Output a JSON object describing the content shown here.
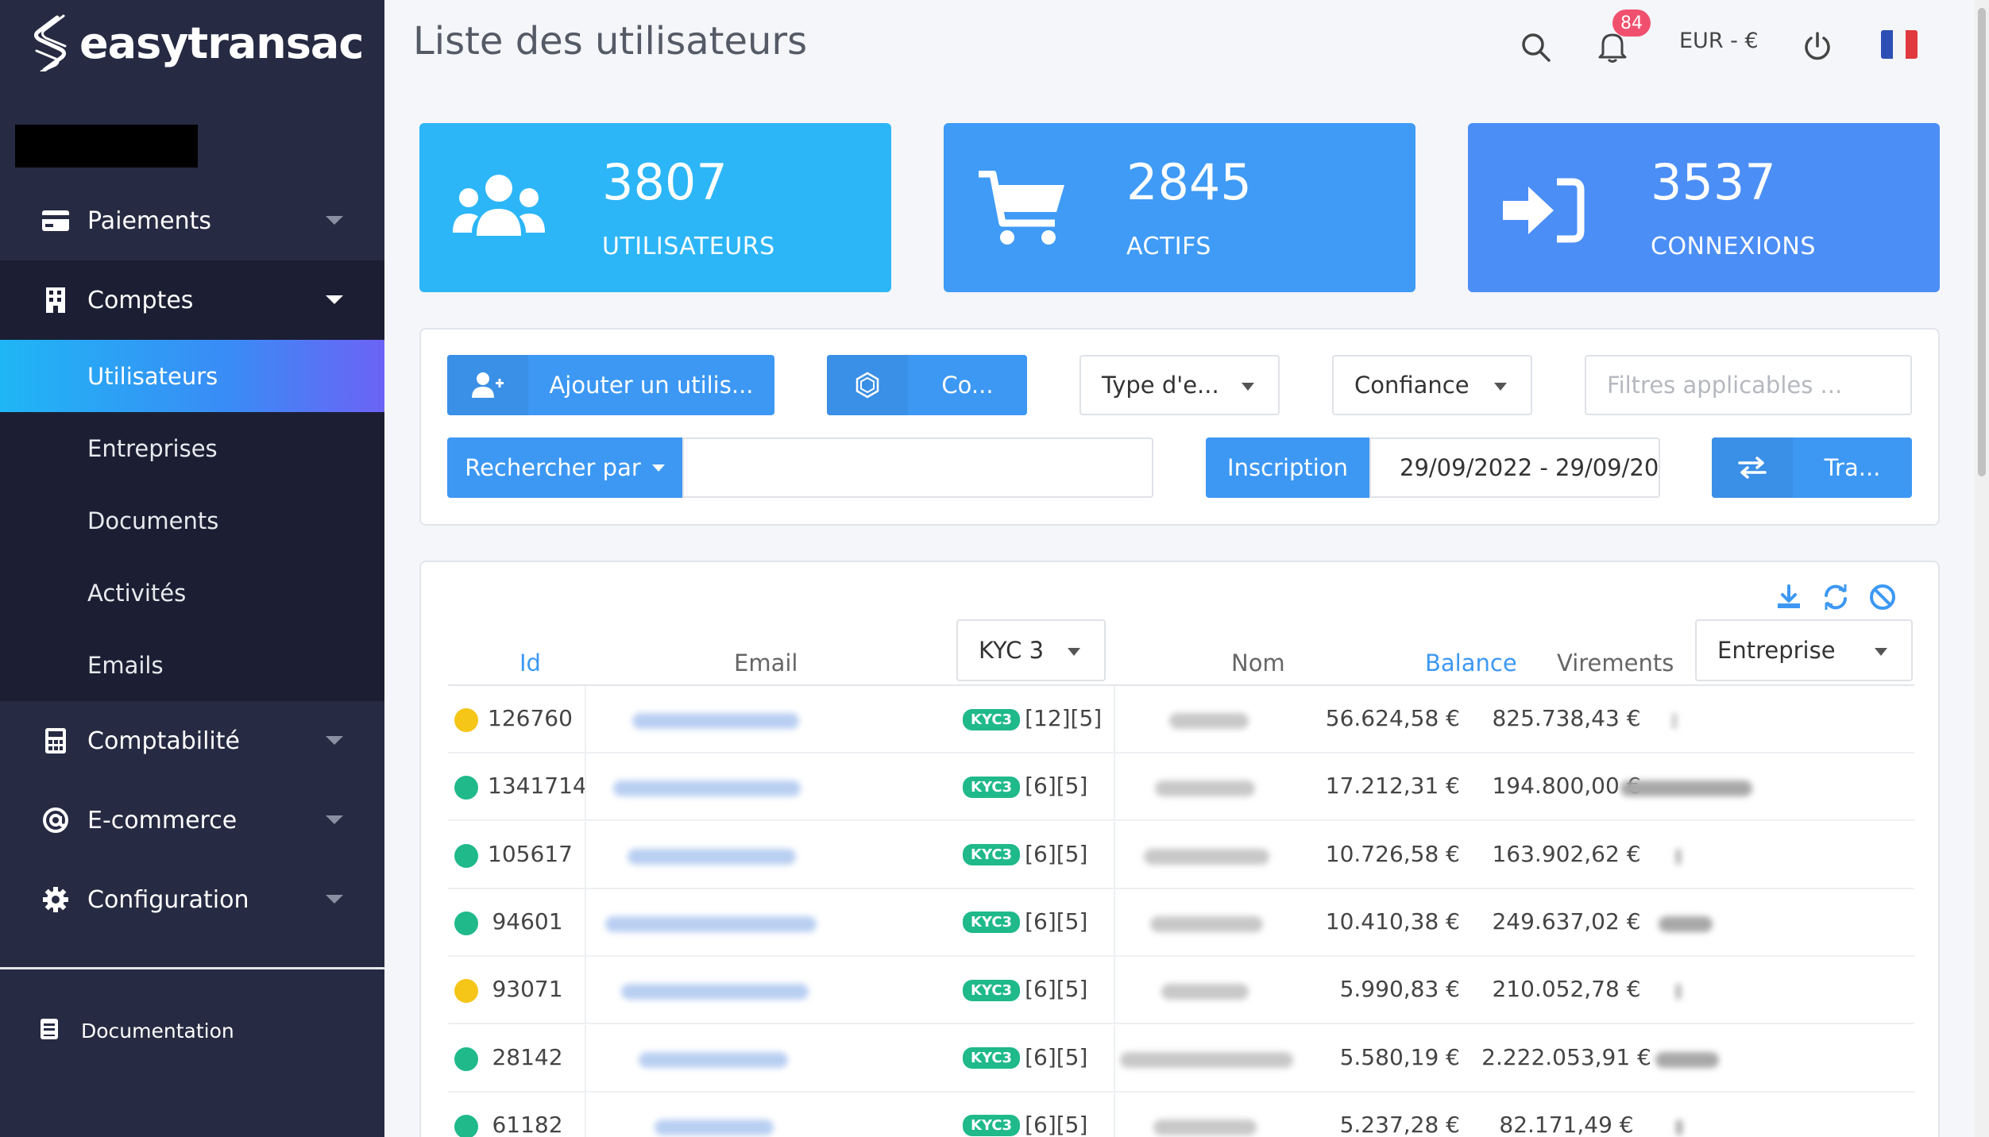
{
  "brand": {
    "name": "easytransac"
  },
  "sidebar": {
    "items": [
      {
        "label": "Paiements",
        "icon": "credit-card-icon"
      },
      {
        "label": "Comptes",
        "icon": "building-icon"
      },
      {
        "label": "Comptabilité",
        "icon": "calculator-icon"
      },
      {
        "label": "E-commerce",
        "icon": "at-icon"
      },
      {
        "label": "Configuration",
        "icon": "gear-icon"
      }
    ],
    "subitems": [
      {
        "label": "Utilisateurs"
      },
      {
        "label": "Entreprises"
      },
      {
        "label": "Documents"
      },
      {
        "label": "Activités"
      },
      {
        "label": "Emails"
      }
    ],
    "documentation": "Documentation"
  },
  "header": {
    "title": "Liste des utilisateurs",
    "notifications": "84",
    "currency": "EUR - €"
  },
  "stats": [
    {
      "value": "3807",
      "label": "UTILISATEURS",
      "icon": "users-icon",
      "color": "#29b6f6"
    },
    {
      "value": "2845",
      "label": "ACTIFS",
      "icon": "cart-icon",
      "color": "#3d9cf5"
    },
    {
      "value": "3537",
      "label": "CONNEXIONS",
      "icon": "sign-in-icon",
      "color": "#4a8ef5"
    }
  ],
  "filters": {
    "add_user": "Ajouter un utilis...",
    "co_button": "Co...",
    "type_select": "Type d'e...",
    "confidence_select": "Confiance",
    "applicable_filters_placeholder": "Filtres applicables ...",
    "search_by": "Rechercher par",
    "search_value": "",
    "date_type": "Inscription",
    "date_range": "29/09/2022 - 29/09/202",
    "transfer_button": "Tra..."
  },
  "table": {
    "headers": {
      "id": "Id",
      "email": "Email",
      "kyc_filter": "KYC 3",
      "name": "Nom",
      "balance": "Balance",
      "transfers": "Virements",
      "company_filter": "Entreprise"
    },
    "rows": [
      {
        "status": "#f5c518",
        "id": "126760",
        "kyc": "KYC3",
        "kyc_extra": "[12][5]",
        "balance": "56.624,58 €",
        "transfers": "825.738,43 €"
      },
      {
        "status": "#1fb98a",
        "id": "1341714",
        "kyc": "KYC3",
        "kyc_extra": "[6][5]",
        "balance": "17.212,31 €",
        "transfers": "194.800,00 €"
      },
      {
        "status": "#1fb98a",
        "id": "105617",
        "kyc": "KYC3",
        "kyc_extra": "[6][5]",
        "balance": "10.726,58 €",
        "transfers": "163.902,62 €"
      },
      {
        "status": "#1fb98a",
        "id": "94601",
        "kyc": "KYC3",
        "kyc_extra": "[6][5]",
        "balance": "10.410,38 €",
        "transfers": "249.637,02 €"
      },
      {
        "status": "#f5c518",
        "id": "93071",
        "kyc": "KYC3",
        "kyc_extra": "[6][5]",
        "balance": "5.990,83 €",
        "transfers": "210.052,78 €"
      },
      {
        "status": "#1fb98a",
        "id": "28142",
        "kyc": "KYC3",
        "kyc_extra": "[6][5]",
        "balance": "5.580,19 €",
        "transfers": "2.222.053,91 €"
      },
      {
        "status": "#1fb98a",
        "id": "61182",
        "kyc": "KYC3",
        "kyc_extra": "[6][5]",
        "balance": "5.237,28 €",
        "transfers": "82.171,49 €"
      }
    ]
  }
}
